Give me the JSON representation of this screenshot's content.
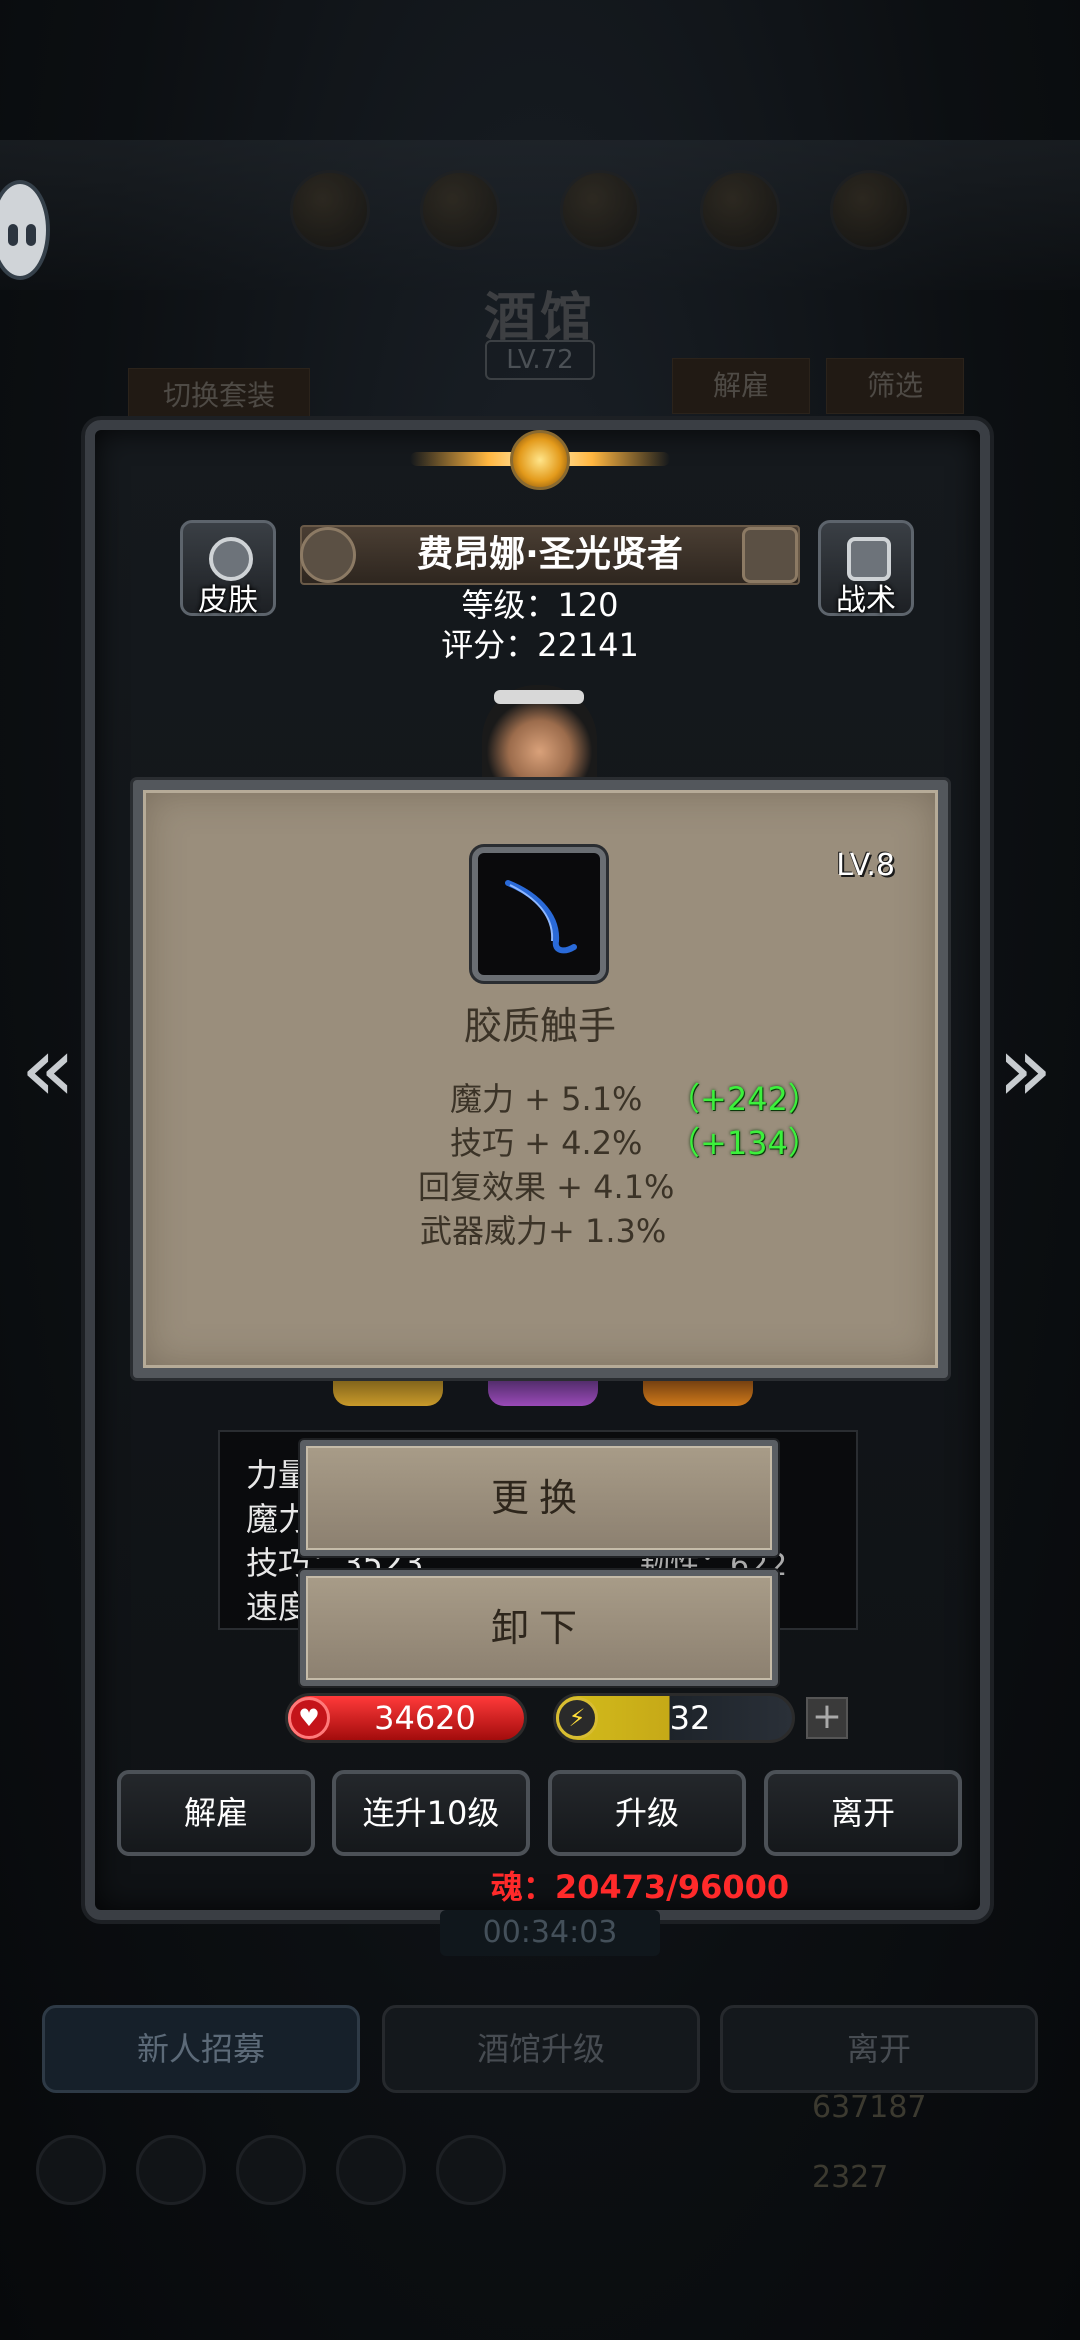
{
  "background": {
    "title": "酒馆",
    "level": "LV.72",
    "switch_set_label": "切换套装",
    "dismiss_label": "解雇",
    "filter_label": "筛选",
    "timer": "00:34:03",
    "bottom_buttons": [
      "新人招募",
      "酒馆升级",
      "离开"
    ],
    "gold": "637187",
    "gems": "2327"
  },
  "hero": {
    "skin_label": "皮肤",
    "tactics_label": "战术",
    "name": "费昂娜·圣光贤者",
    "level": "等级：120",
    "score": "评分：22141",
    "stats_partial": [
      "力量",
      "魔力",
      "技巧：3523",
      "速度"
    ],
    "stats_right_partial": "韧性：622",
    "hp": "34620",
    "energy": "32",
    "energy_fraction": 0.48,
    "actions": [
      "解雇",
      "连升10级",
      "升级",
      "离开"
    ],
    "soul": "魂：20473/96000"
  },
  "item_popup": {
    "level": "LV.8",
    "name": "胶质触手",
    "attributes": [
      {
        "text": "魔力 + 5.1%",
        "bonus": "（+242）"
      },
      {
        "text": "技巧 + 4.2%",
        "bonus": "（+134）"
      },
      {
        "text": "回复效果 + 4.1%",
        "bonus": ""
      },
      {
        "text": "武器威力+ 1.3%",
        "bonus": ""
      }
    ],
    "replace_label": "更换",
    "unequip_label": "卸下"
  },
  "icons": {
    "left_arrow": "double-chevron-left-icon",
    "right_arrow": "double-chevron-right-icon",
    "hp": "heart-icon",
    "energy": "lightning-icon",
    "plus": "plus-icon"
  },
  "colors": {
    "soul_text": "#ff2a2a",
    "bonus_text": "#3cf03c",
    "hp_bar": "#d31818",
    "energy_bar": "#d4bd1c",
    "popup_bg": "#9a8e7c"
  }
}
